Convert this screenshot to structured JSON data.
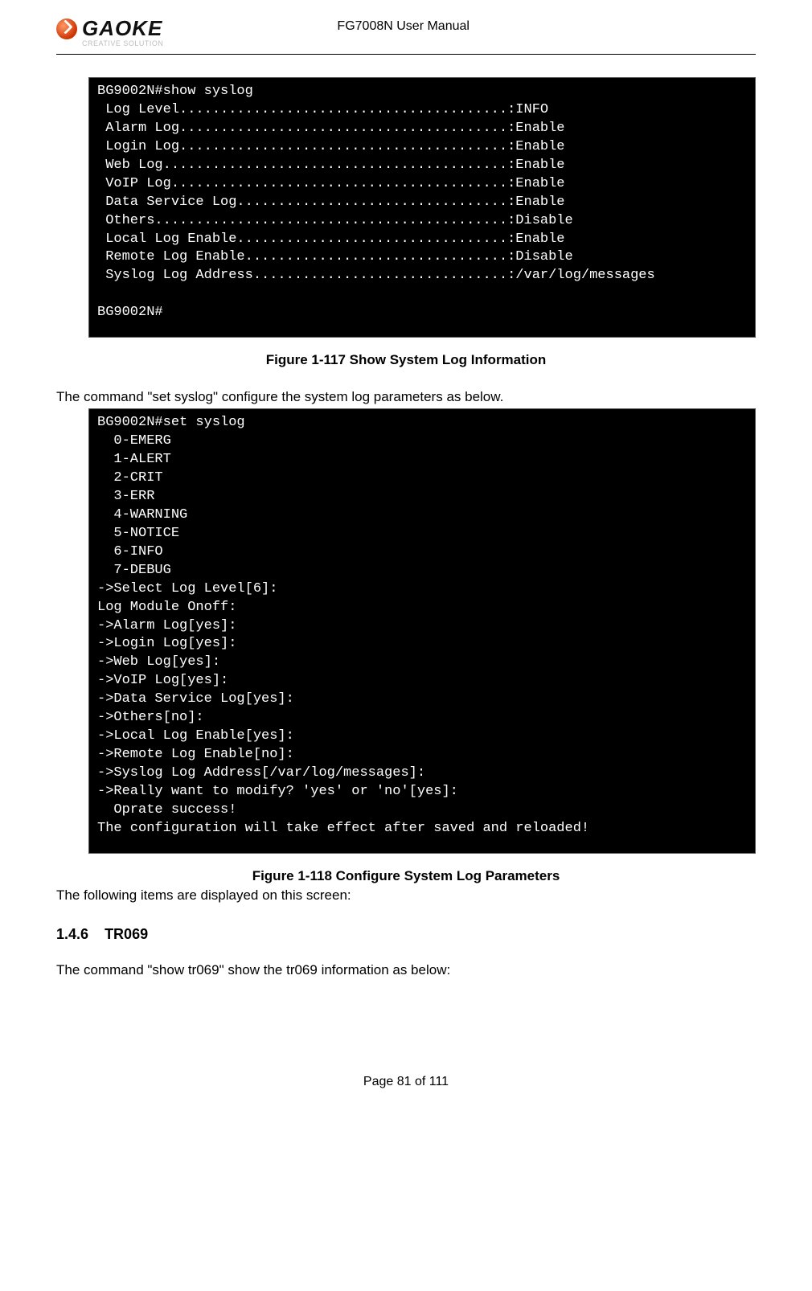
{
  "header": {
    "logo_text": "GAOKE",
    "logo_sub": "CREATIVE SOLUTION",
    "doc_title": "FG7008N User Manual"
  },
  "terminal1": {
    "text": "BG9002N#show syslog\n Log Level........................................:INFO\n Alarm Log........................................:Enable\n Login Log........................................:Enable\n Web Log..........................................:Enable\n VoIP Log.........................................:Enable\n Data Service Log.................................:Enable\n Others...........................................:Disable\n Local Log Enable.................................:Enable\n Remote Log Enable................................:Disable\n Syslog Log Address...............................:/var/log/messages\n\nBG9002N#"
  },
  "caption1": "Figure 1-117  Show System Log Information",
  "para1": "The command \"set syslog\" configure the system log parameters as below.",
  "terminal2": {
    "text": "BG9002N#set syslog\n  0-EMERG\n  1-ALERT\n  2-CRIT\n  3-ERR\n  4-WARNING\n  5-NOTICE\n  6-INFO\n  7-DEBUG\n->Select Log Level[6]:\nLog Module Onoff:\n->Alarm Log[yes]:\n->Login Log[yes]:\n->Web Log[yes]:\n->VoIP Log[yes]:\n->Data Service Log[yes]:\n->Others[no]:\n->Local Log Enable[yes]:\n->Remote Log Enable[no]:\n->Syslog Log Address[/var/log/messages]:\n->Really want to modify? 'yes' or 'no'[yes]:\n  Oprate success!\nThe configuration will take effect after saved and reloaded!"
  },
  "caption2": "Figure 1-118  Configure System Log Parameters",
  "para2": "The following items are displayed on this screen:",
  "section": {
    "number": "1.4.6",
    "title": "TR069"
  },
  "para3": "The command \"show tr069\" show the tr069 information as below:",
  "footer": "Page 81 of 111"
}
